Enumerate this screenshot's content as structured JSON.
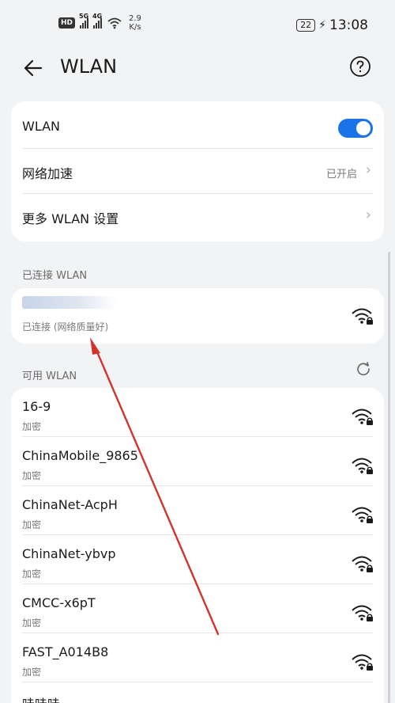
{
  "status_bar": {
    "hd_label": "HD",
    "signal1_label": "5G",
    "signal2_label": "4G",
    "speed_value": "2.9",
    "speed_unit": "K/s",
    "battery": "22",
    "time": "13:08"
  },
  "header": {
    "title": "WLAN"
  },
  "settings": {
    "wlan_label": "WLAN",
    "wlan_enabled": true,
    "accel_label": "网络加速",
    "accel_value": "已开启",
    "more_label": "更多 WLAN 设置"
  },
  "connected": {
    "section_label": "已连接 WLAN",
    "status": "已连接 (网络质量好)"
  },
  "available": {
    "section_label": "可用 WLAN",
    "networks": [
      {
        "ssid": "16-9",
        "security": "加密"
      },
      {
        "ssid": "ChinaMobile_9865",
        "security": "加密"
      },
      {
        "ssid": "ChinaNet-AcpH",
        "security": "加密"
      },
      {
        "ssid": "ChinaNet-ybvp",
        "security": "加密"
      },
      {
        "ssid": "CMCC-x6pT",
        "security": "加密"
      },
      {
        "ssid": "FAST_A014B8",
        "security": "加密"
      },
      {
        "ssid": "哇哇哇",
        "security": ""
      }
    ]
  },
  "colors": {
    "accent": "#1a73e8",
    "annotation_arrow": "#d0342c"
  },
  "icons": {
    "back": "arrow-left-icon",
    "help": "question-circle-icon",
    "wifi": "wifi-lock-icon",
    "refresh": "refresh-icon",
    "chevron": "chevron-right-icon"
  }
}
